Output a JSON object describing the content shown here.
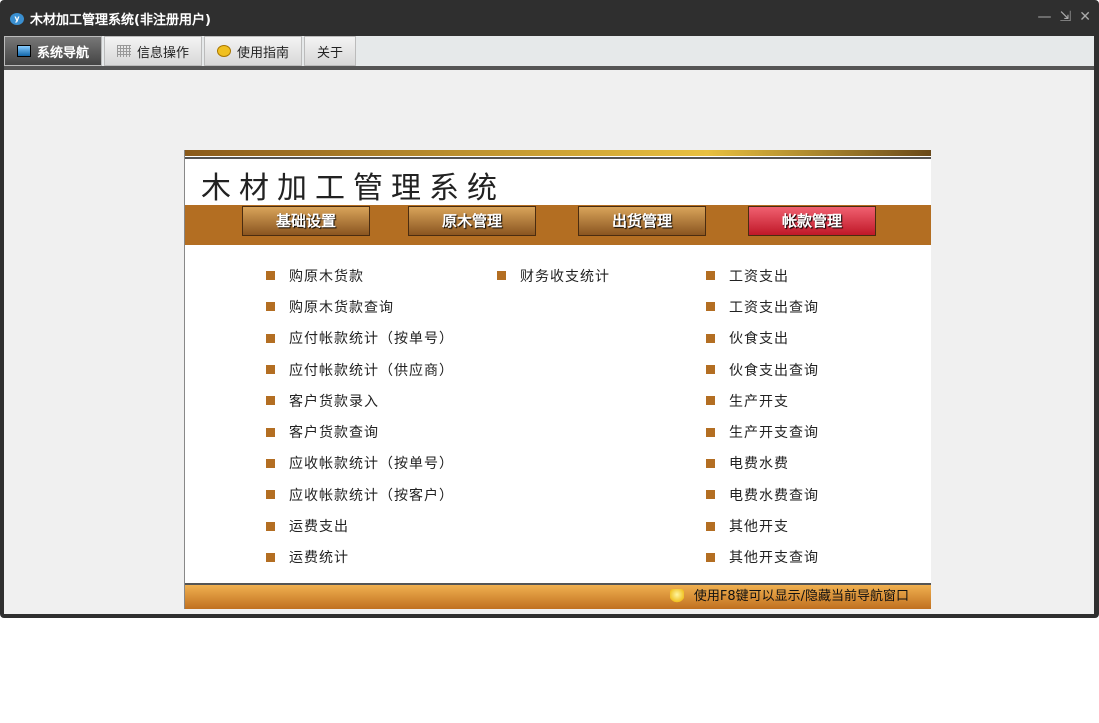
{
  "window": {
    "title": "木材加工管理系统(非注册用户)",
    "controls": [
      "—",
      "⇲",
      "✕"
    ]
  },
  "tabs": [
    {
      "label": "系统导航",
      "icon": "monitor-icon"
    },
    {
      "label": "信息操作",
      "icon": "grid-icon"
    },
    {
      "label": "使用指南",
      "icon": "help-icon"
    },
    {
      "label": "关于"
    }
  ],
  "panel": {
    "title": "木材加工管理系统",
    "nav": [
      "基础设置",
      "原木管理",
      "出货管理",
      "帐款管理"
    ],
    "col1": [
      "购原木货款",
      "购原木货款查询",
      "应付帐款统计（按单号）",
      "应付帐款统计（供应商）",
      "客户货款录入",
      "客户货款查询",
      "应收帐款统计（按单号）",
      "应收帐款统计（按客户）",
      "运费支出",
      "运费统计"
    ],
    "col2": [
      "财务收支统计"
    ],
    "col3": [
      "工资支出",
      "工资支出查询",
      "伙食支出",
      "伙食支出查询",
      "生产开支",
      "生产开支查询",
      "电费水费",
      "电费水费查询",
      "其他开支",
      "其他开支查询"
    ],
    "footer": "使用F8键可以显示/隐藏当前导航窗口"
  },
  "colors": {
    "accent": "#b36e22",
    "active": "#d02030"
  }
}
